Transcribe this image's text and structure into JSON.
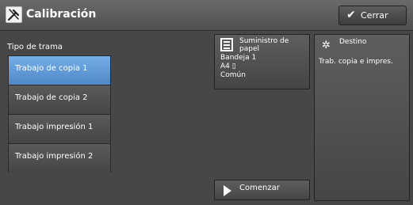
{
  "header": {
    "title": "Calibración",
    "close_label": "Cerrar"
  },
  "screen_type": {
    "label": "Tipo de trama",
    "items": [
      {
        "label": "Trabajo de copia 1",
        "selected": true
      },
      {
        "label": "Trabajo de copia 2",
        "selected": false
      },
      {
        "label": "Trabajo impresión 1",
        "selected": false
      },
      {
        "label": "Trabajo impresión 2",
        "selected": false
      }
    ]
  },
  "paper_supply": {
    "title": "Suministro de papel",
    "tray": "Bandeja 1",
    "size": "A4 ▯",
    "type": "Común"
  },
  "destination": {
    "title": "Destino",
    "value": "Trab. copia e impres."
  },
  "start": {
    "label": "Comenzar"
  },
  "colors": {
    "selected": "#5b94d2",
    "background": "#474747"
  }
}
